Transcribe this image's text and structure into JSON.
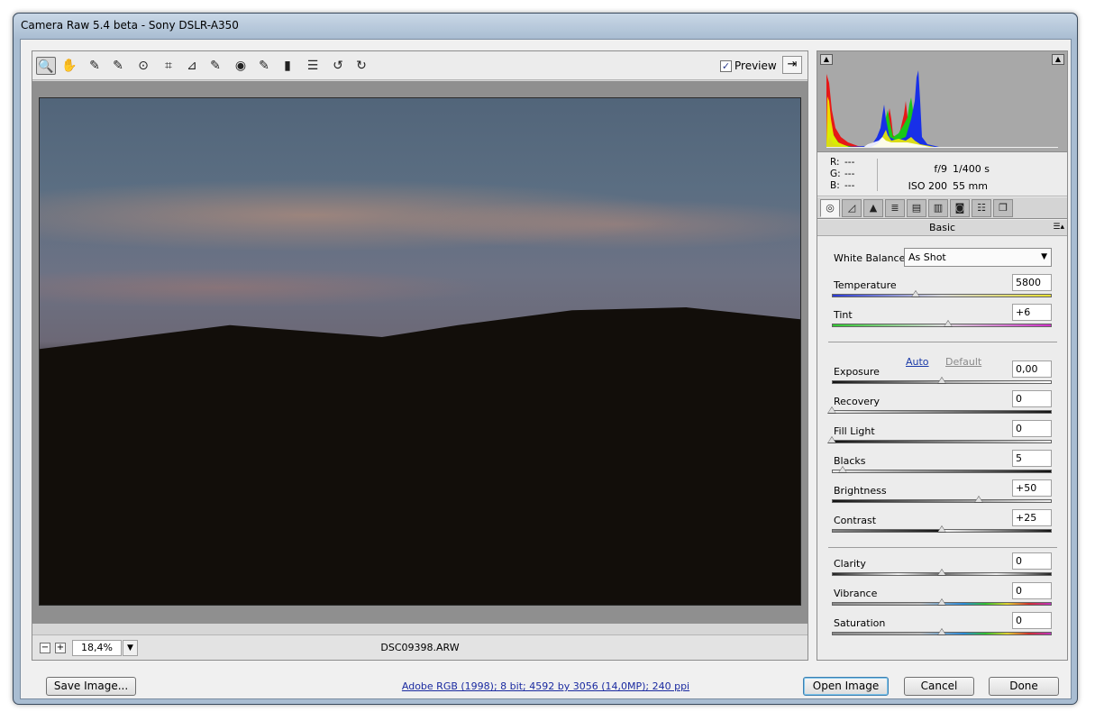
{
  "window": {
    "title": "Camera Raw 5.4 beta  -  Sony DSLR-A350"
  },
  "toolbar": {
    "tools": [
      "zoom-icon",
      "hand-icon",
      "eyedropper-icon",
      "color-sampler-icon",
      "targeted-adjustment-icon",
      "crop-icon",
      "straighten-icon",
      "spot-removal-icon",
      "red-eye-icon",
      "adjustment-brush-icon",
      "graduated-filter-icon",
      "preferences-icon",
      "rotate-ccw-icon",
      "rotate-cw-icon"
    ],
    "tool_glyphs": [
      "🔍",
      "✋",
      "✎",
      "✎",
      "⊙",
      "⌗",
      "⊿",
      "✎",
      "◉",
      "✎",
      "▮",
      "☰",
      "↺",
      "↻"
    ],
    "preview_label": "Preview",
    "preview_checked": "✓",
    "fullscreen_glyph": "⇥"
  },
  "status": {
    "zoom_minus": "−",
    "zoom_plus": "+",
    "zoom_value": "18,4%",
    "zoom_drop": "▼",
    "filename": "DSC09398.ARW"
  },
  "histogram": {
    "shadow_clip_glyph": "▲",
    "highlight_clip_glyph": "▲"
  },
  "readout": {
    "r_label": "R:",
    "r_value": "---",
    "g_label": "G:",
    "g_value": "---",
    "b_label": "B:",
    "b_value": "---",
    "aperture": "f/9",
    "shutter": "1/400 s",
    "iso": "ISO 200",
    "focal": "55 mm"
  },
  "tabs": {
    "icons": [
      "basic-tab-icon",
      "tone-curve-tab-icon",
      "detail-tab-icon",
      "hsl-tab-icon",
      "split-toning-tab-icon",
      "lens-corrections-tab-icon",
      "camera-calibration-tab-icon",
      "presets-tab-icon",
      "snapshots-tab-icon"
    ],
    "glyphs": [
      "◎",
      "◿",
      "▲",
      "≣",
      "▤",
      "▥",
      "◙",
      "☷",
      "❐"
    ]
  },
  "panel": {
    "title": "Basic",
    "menu_glyph": "☰▴",
    "white_balance_label": "White Balance:",
    "white_balance_value": "As Shot",
    "auto_label": "Auto",
    "default_label": "Default"
  },
  "sliders": {
    "temperature": {
      "label": "Temperature",
      "value": "5800",
      "position": 0.38
    },
    "tint": {
      "label": "Tint",
      "value": "+6",
      "position": 0.53
    },
    "exposure": {
      "label": "Exposure",
      "value": "0,00",
      "position": 0.5
    },
    "recovery": {
      "label": "Recovery",
      "value": "0",
      "position": 0.0
    },
    "fill_light": {
      "label": "Fill Light",
      "value": "0",
      "position": 0.0
    },
    "blacks": {
      "label": "Blacks",
      "value": "5",
      "position": 0.05
    },
    "brightness": {
      "label": "Brightness",
      "value": "+50",
      "position": 0.667
    },
    "contrast": {
      "label": "Contrast",
      "value": "+25",
      "position": 0.5
    },
    "clarity": {
      "label": "Clarity",
      "value": "0",
      "position": 0.5
    },
    "vibrance": {
      "label": "Vibrance",
      "value": "0",
      "position": 0.5
    },
    "saturation": {
      "label": "Saturation",
      "value": "0",
      "position": 0.5
    }
  },
  "footer": {
    "save_label": "Save Image...",
    "workflow_link": "Adobe RGB (1998); 8 bit; 4592 by 3056 (14,0MP); 240 ppi",
    "open_label": "Open Image",
    "cancel_label": "Cancel",
    "done_label": "Done"
  }
}
